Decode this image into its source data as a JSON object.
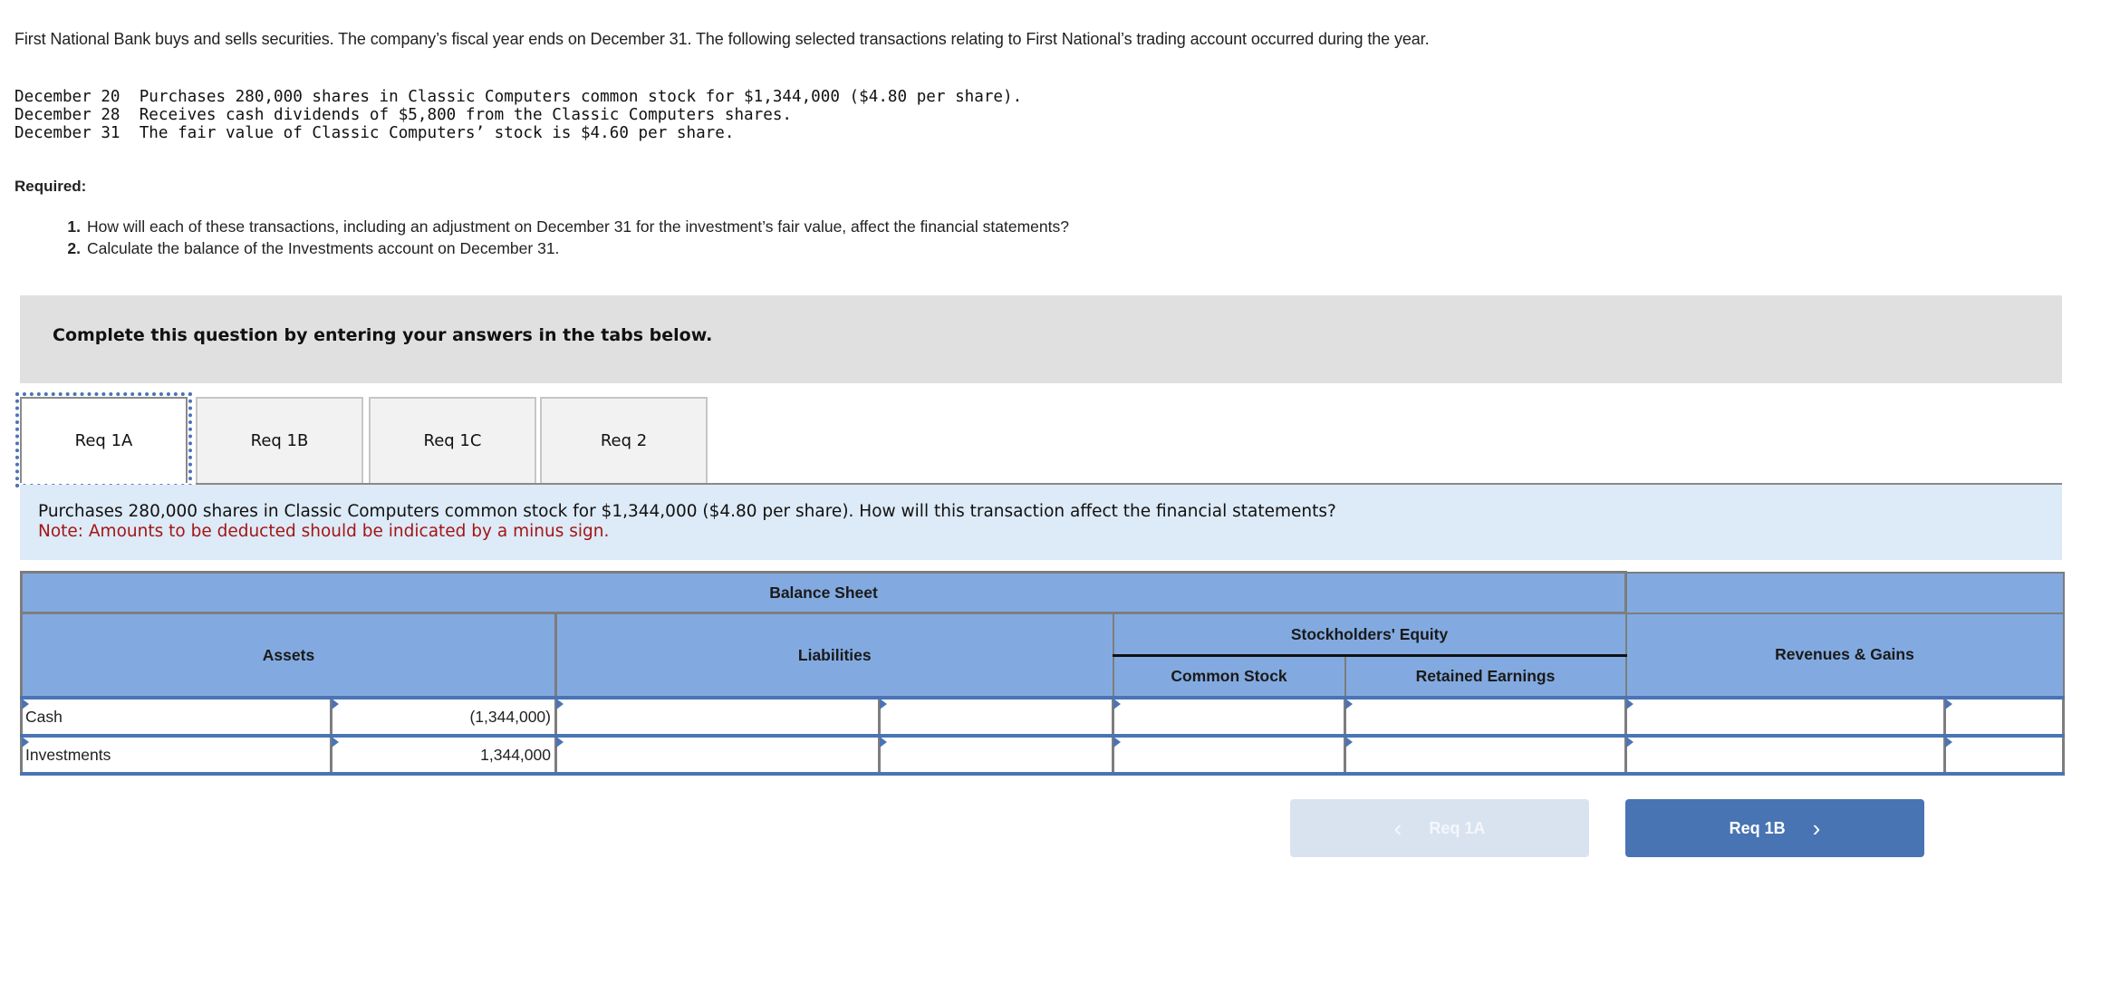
{
  "intro": "First National Bank buys and sells securities. The company’s fiscal year ends on December 31. The following selected transactions relating to First National’s trading account occurred during the year.",
  "transactions": [
    {
      "date": "December 20",
      "text": "Purchases 280,000 shares in Classic Computers common stock for $1,344,000 ($4.80 per share)."
    },
    {
      "date": "December 28",
      "text": "Receives cash dividends of $5,800 from the Classic Computers shares."
    },
    {
      "date": "December 31",
      "text": "The fair value of Classic Computers’ stock is $4.60 per share."
    }
  ],
  "required_label": "Required:",
  "requirements": [
    {
      "num": "1.",
      "text": "How will each of these transactions, including an adjustment on December 31 for the investment’s fair value, affect the financial statements?"
    },
    {
      "num": "2.",
      "text": "Calculate the balance of the Investments account on December 31."
    }
  ],
  "instruction": "Complete this question by entering your answers in the tabs below.",
  "tabs": [
    {
      "label": "Req 1A",
      "active": true
    },
    {
      "label": "Req 1B",
      "active": false
    },
    {
      "label": "Req 1C",
      "active": false
    },
    {
      "label": "Req 2",
      "active": false
    }
  ],
  "question": {
    "text": "Purchases 280,000 shares in Classic Computers common stock for $1,344,000 ($4.80 per share). How will this transaction affect the financial statements?",
    "note": "Note: Amounts to be deducted should be indicated by a minus sign."
  },
  "table": {
    "headers": {
      "balance_sheet": "Balance Sheet",
      "income_statement": "",
      "assets": "Assets",
      "liabilities": "Liabilities",
      "stockholders_equity": "Stockholders' Equity",
      "common_stock": "Common Stock",
      "retained_earnings": "Retained Earnings",
      "revenues_gains": "Revenues & Gains"
    },
    "rows": [
      {
        "asset_account": "Cash",
        "asset_amount": "(1,344,000)",
        "liab_account": "",
        "liab_amount": "",
        "common_stock": "",
        "retained_earnings": "",
        "rev_account": "",
        "rev_amount": ""
      },
      {
        "asset_account": "Investments",
        "asset_amount": "1,344,000",
        "liab_account": "",
        "liab_amount": "",
        "common_stock": "",
        "retained_earnings": "",
        "rev_account": "",
        "rev_amount": ""
      }
    ]
  },
  "nav": {
    "prev_label": "Req 1A",
    "next_label": "Req 1B",
    "prev_icon": "chevron-left-icon",
    "next_icon": "chevron-right-icon",
    "prev_glyph": "‹",
    "next_glyph": "›"
  },
  "colors": {
    "header_blue": "#82aae0",
    "input_border_blue": "#4a74b4",
    "note_red": "#a31515",
    "question_bg": "#ddeaf7",
    "button_blue": "#4874b3",
    "button_disabled": "#d9e3f0"
  }
}
